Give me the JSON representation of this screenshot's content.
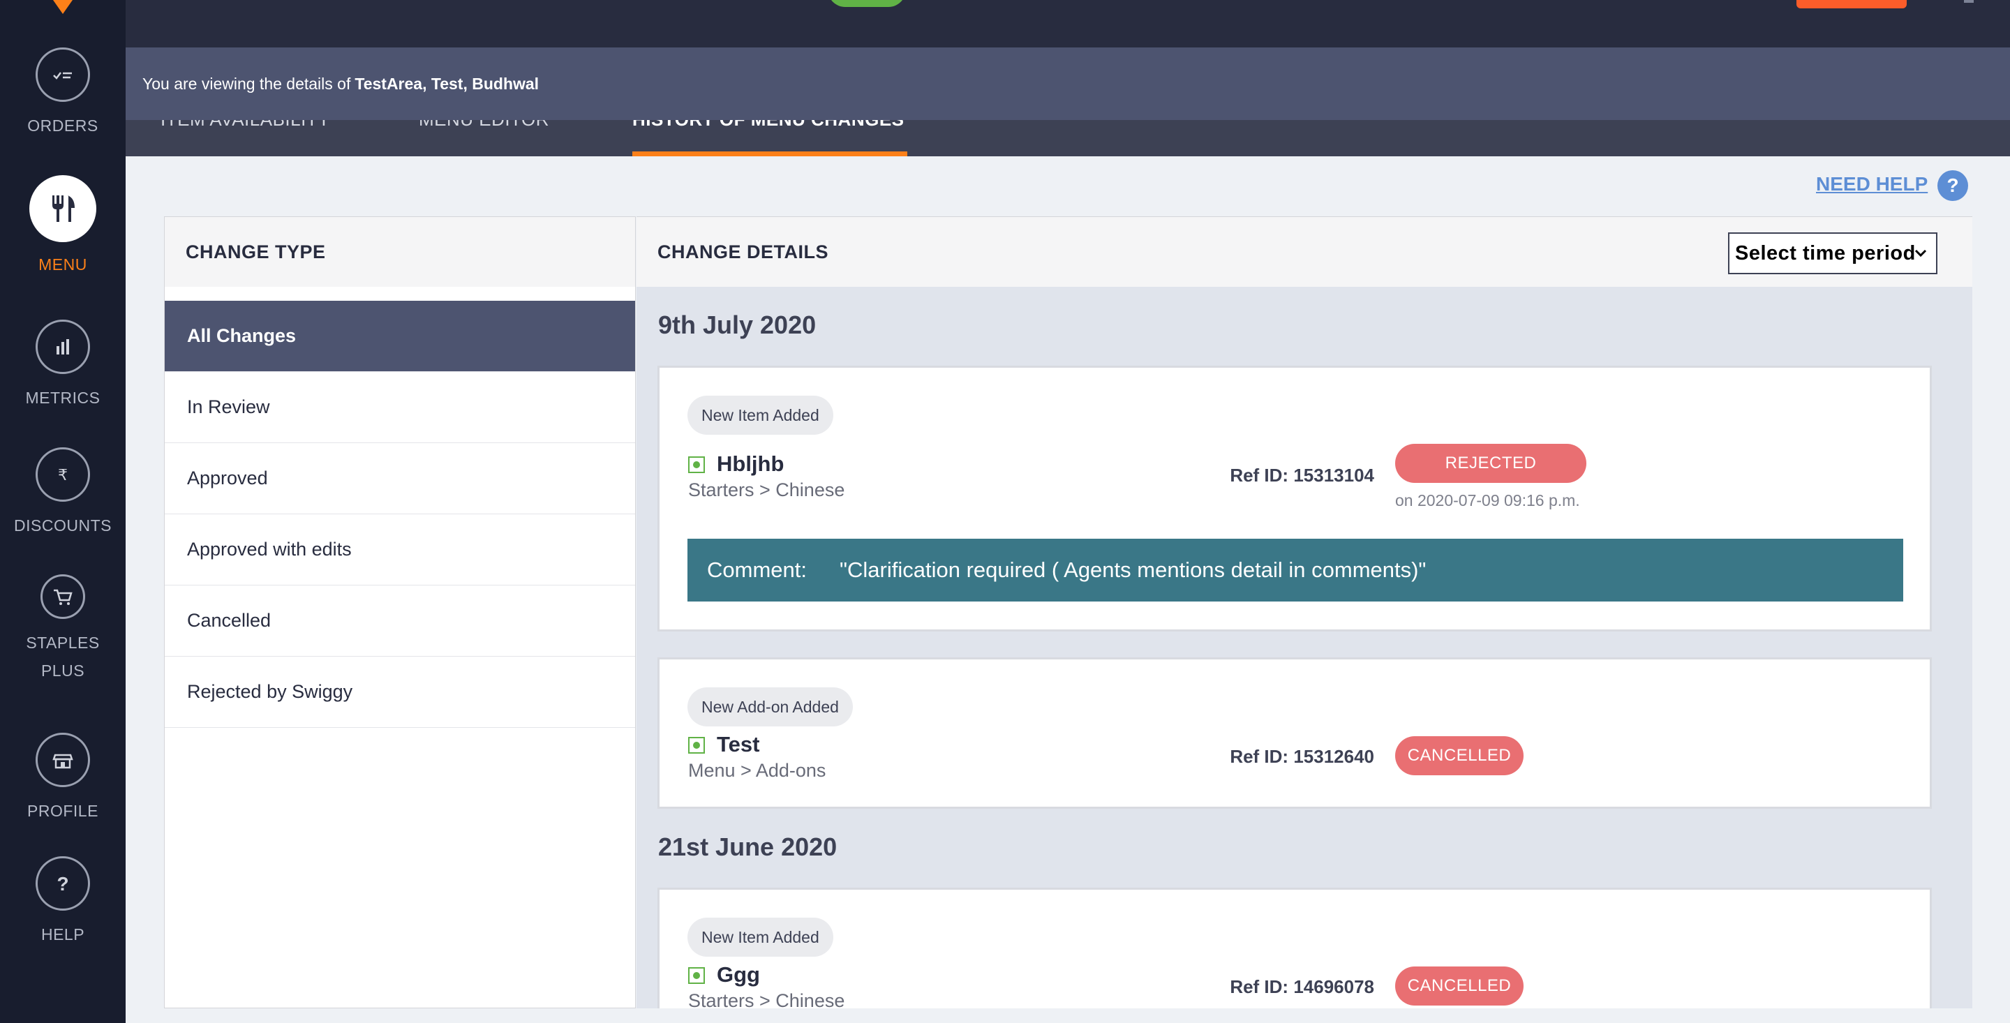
{
  "sidebar": {
    "items": [
      {
        "label": "ORDERS",
        "icon": "orders-icon",
        "active": false
      },
      {
        "label": "MENU",
        "icon": "fork-knife-icon",
        "active": true
      },
      {
        "label": "METRICS",
        "icon": "bar-chart-icon",
        "active": false
      },
      {
        "label": "DISCOUNTS",
        "icon": "rupee-icon",
        "active": false
      },
      {
        "label": "STAPLES",
        "label2": "PLUS",
        "icon": "cart-icon",
        "active": false
      },
      {
        "label": "PROFILE",
        "icon": "store-icon",
        "active": false
      },
      {
        "label": "HELP",
        "icon": "question-icon",
        "active": false
      }
    ]
  },
  "banner": {
    "prefix": "You are viewing the details of",
    "outlet": "TestArea, Test, Budhwal"
  },
  "tabs": [
    {
      "label": "ITEM AVAILABILITY"
    },
    {
      "label": "MENU EDITOR"
    },
    {
      "label": "HISTORY OF MENU CHANGES"
    }
  ],
  "help": {
    "label": "NEED HELP",
    "icon_glyph": "?"
  },
  "change_type": {
    "title": "CHANGE TYPE",
    "items": [
      "All Changes",
      "In Review",
      "Approved",
      "Approved with edits",
      "Cancelled",
      "Rejected by Swiggy"
    ],
    "selected": "All Changes"
  },
  "change_details": {
    "title": "CHANGE DETAILS",
    "time_select": {
      "value": "Select time period"
    },
    "groups": [
      {
        "date": "9th July 2020",
        "cards": [
          {
            "chip": "New Item Added",
            "name": "Hbljhb",
            "path": "Starters > Chinese",
            "ref": "Ref ID: 15313104",
            "status": "REJECTED",
            "status_time": "on 2020-07-09 09:16 p.m.",
            "comment_label": "Comment:",
            "comment": "\"Clarification required ( Agents mentions detail in comments)\""
          },
          {
            "chip": "New Add-on Added",
            "name": "Test",
            "path": "Menu > Add-ons",
            "ref": "Ref ID: 15312640",
            "status": "CANCELLED"
          }
        ]
      },
      {
        "date": "21st June 2020",
        "cards": [
          {
            "chip": "New Item Added",
            "name": "Ggg",
            "path": "Starters > Chinese",
            "ref": "Ref ID: 14696078",
            "status": "CANCELLED"
          }
        ]
      }
    ]
  },
  "colors": {
    "accent": "#fc8019",
    "status_red": "#e96f72",
    "comment_teal": "#3a7787",
    "veg_green": "#60b246",
    "sidebar_bg": "#181d2e",
    "banner_bg": "#4d5470"
  }
}
